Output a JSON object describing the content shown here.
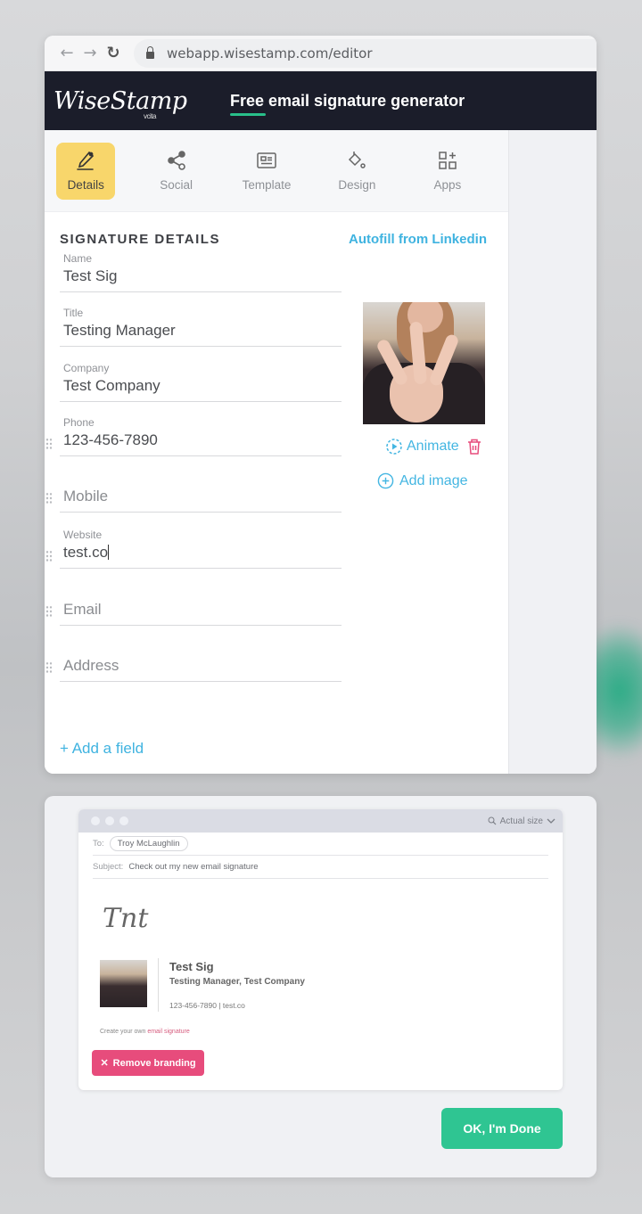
{
  "browser": {
    "url": "webapp.wisestamp.com/editor"
  },
  "header": {
    "logo": "WiseStamp",
    "logo_sub": "vcita",
    "tagline_highlight": "Free",
    "tagline_rest": " email signature generator"
  },
  "tabs": [
    {
      "label": "Details",
      "icon": "pencil-icon",
      "active": true
    },
    {
      "label": "Social",
      "icon": "share-icon",
      "active": false
    },
    {
      "label": "Template",
      "icon": "template-card-icon",
      "active": false
    },
    {
      "label": "Design",
      "icon": "paint-bucket-icon",
      "active": false
    },
    {
      "label": "Apps",
      "icon": "apps-grid-plus-icon",
      "active": false
    }
  ],
  "details": {
    "section_title": "SIGNATURE DETAILS",
    "autofill_label": "Autofill from Linkedin",
    "fields": [
      {
        "label": "Name",
        "value": "Test Sig"
      },
      {
        "label": "Title",
        "value": "Testing Manager"
      },
      {
        "label": "Company",
        "value": "Test Company"
      },
      {
        "label": "Phone",
        "value": "123-456-7890"
      },
      {
        "label": "",
        "placeholder": "Mobile",
        "value": ""
      },
      {
        "label": "Website",
        "value": "test.co"
      },
      {
        "label": "",
        "placeholder": "Email",
        "value": ""
      },
      {
        "label": "",
        "placeholder": "Address",
        "value": ""
      }
    ],
    "add_field_label": "+ Add a field",
    "animate_label": "Animate",
    "add_image_label": "Add image"
  },
  "preview": {
    "zoom_label": "Actual size",
    "to_label": "To:",
    "to_value": "Troy McLaughlin",
    "subject_label": "Subject:",
    "subject_value": "Check out my new email signature",
    "handwritten": "Tnt",
    "sig_name": "Test Sig",
    "sig_title": "Testing Manager, Test Company",
    "sig_contact": "123-456-7890  |  test.co",
    "branding_text": "Create your own ",
    "branding_link": "email signature",
    "remove_branding_label": "Remove branding",
    "done_label": "OK, I'm Done"
  },
  "colors": {
    "header_bg": "#1b1d2a",
    "active_tab": "#f8d66b",
    "accent_blue": "#3fb3e0",
    "delete_red": "#e74c7c",
    "done_green": "#2fc592"
  }
}
